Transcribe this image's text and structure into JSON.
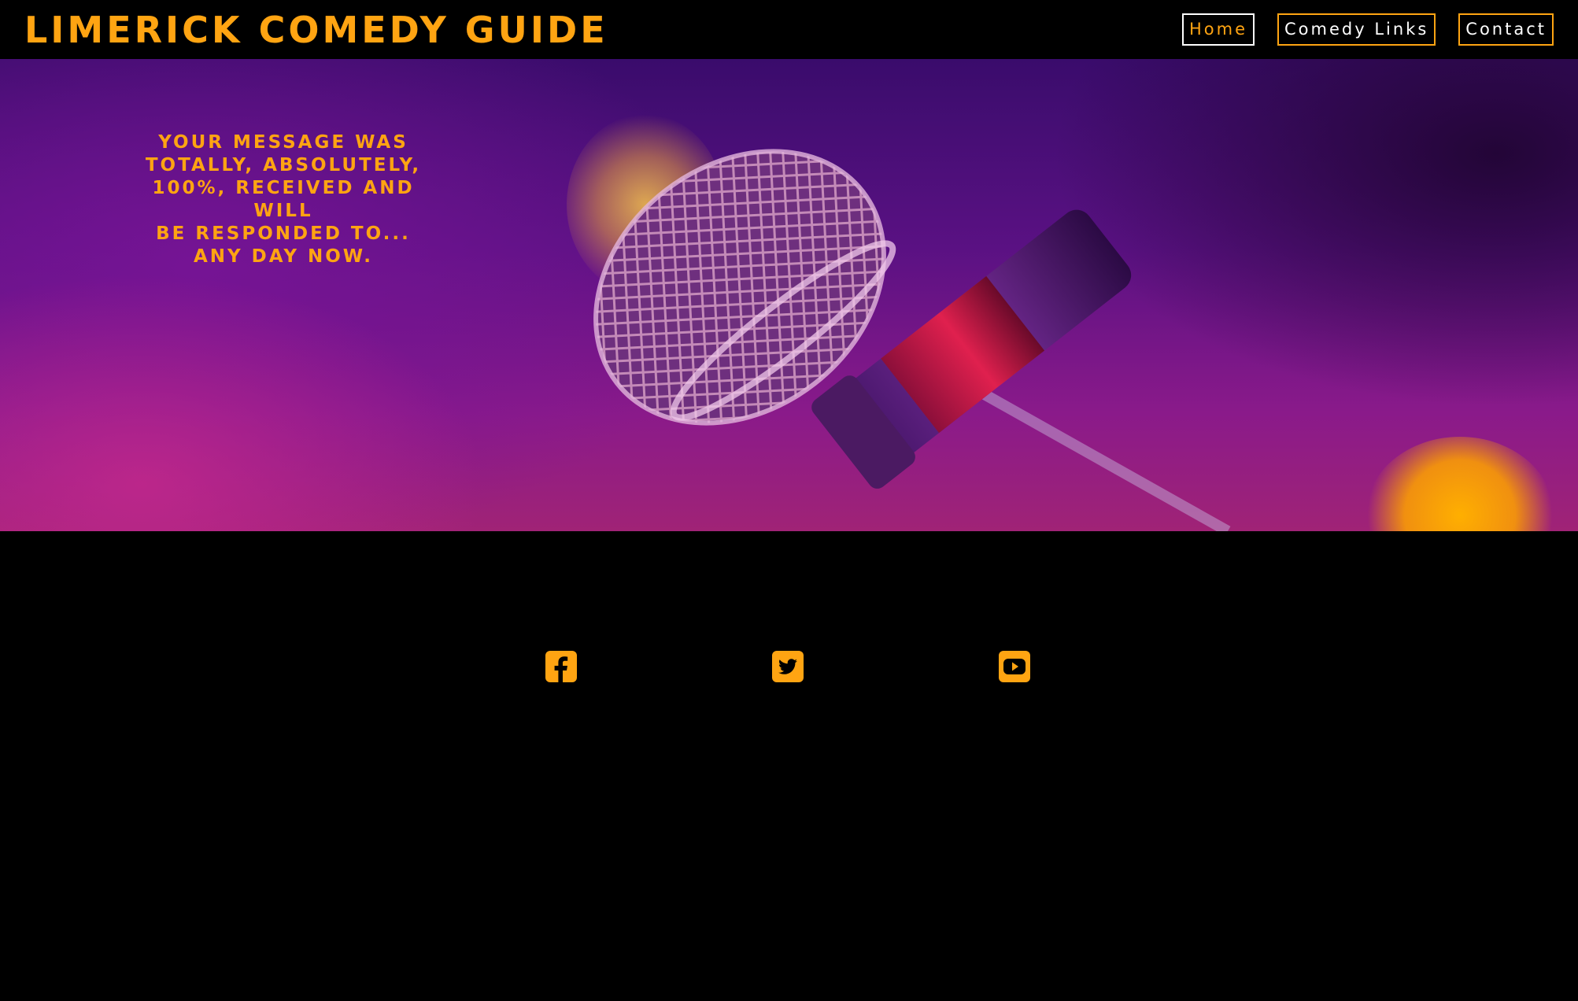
{
  "header": {
    "brand": "LIMERICK COMEDY GUIDE",
    "nav": [
      {
        "label": "Home",
        "active": true
      },
      {
        "label": "Comedy Links",
        "active": false
      },
      {
        "label": "Contact",
        "active": false
      }
    ]
  },
  "hero": {
    "message": "YOUR MESSAGE WAS\nTOTALLY, ABSOLUTELY,\n100%, RECEIVED AND WILL\nBE RESPONDED TO...\nANY DAY NOW."
  },
  "footer": {
    "social": [
      {
        "icon": "facebook-icon"
      },
      {
        "icon": "twitter-icon"
      },
      {
        "icon": "youtube-icon"
      }
    ]
  },
  "colors": {
    "accent": "#ffa412",
    "background": "#000000",
    "nav_text": "#ffffff"
  }
}
